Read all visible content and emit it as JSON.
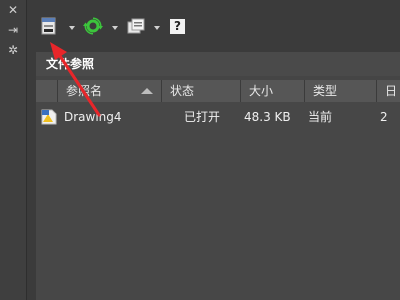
{
  "side_strip": {
    "close_glyph": "✕",
    "pin_glyph": "⇥",
    "settings_glyph": "✲"
  },
  "toolbar": {
    "attach_icon": "attach-dwg-icon",
    "refresh_icon": "refresh-icon",
    "change_path_icon": "change-path-icon",
    "help_glyph": "?"
  },
  "panel": {
    "title": "文件参照",
    "columns": [
      "参照名",
      "状态",
      "大小",
      "类型",
      "日"
    ],
    "rows": [
      {
        "name": "Drawing4",
        "status": "已打开",
        "size": "48.3 KB",
        "type": "当前",
        "date": "2"
      }
    ]
  },
  "colors": {
    "accent_arrow": "#e8262a",
    "refresh_green": "#3cc43c",
    "background": "#3b3b3b"
  }
}
